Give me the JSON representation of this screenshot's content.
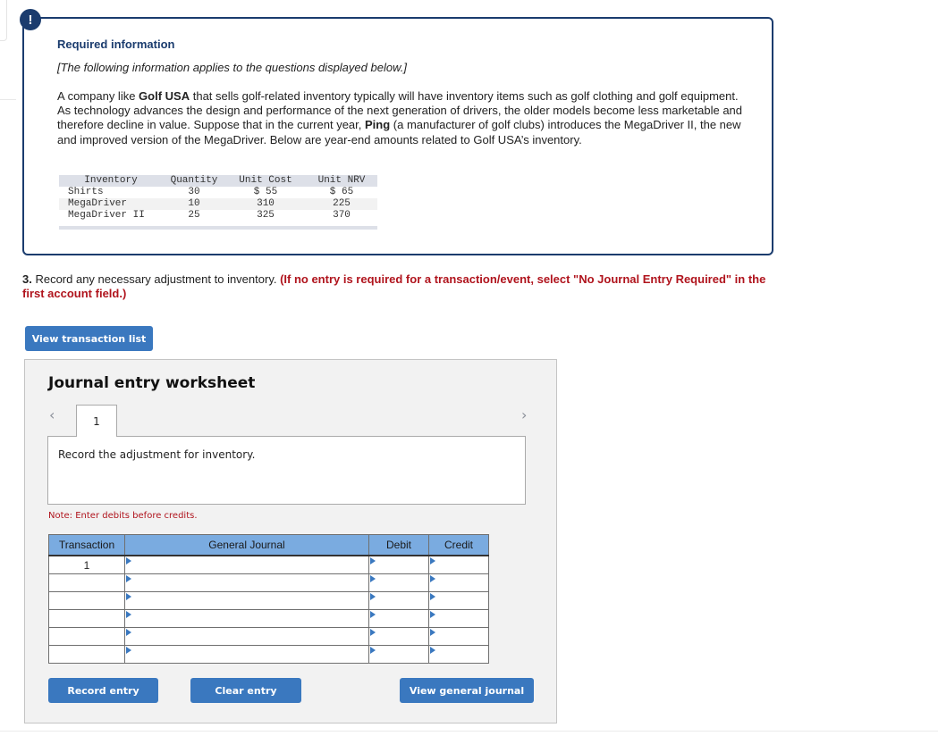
{
  "info": {
    "badge": "!",
    "title": "Required information",
    "subtitle": "[The following information applies to the questions displayed below.]",
    "paragraph_parts": {
      "p1": "A company like ",
      "b1": "Golf USA",
      "p2": " that sells golf-related inventory typically will have inventory items such as golf clothing and golf equipment. As technology advances the design and performance of the next generation of drivers, the older models become less marketable and therefore decline in value. Suppose that in the current year, ",
      "b2": "Ping",
      "p3": " (a manufacturer of golf clubs) introduces the MegaDriver II, the new and improved version of the MegaDriver. Below are year-end amounts related to Golf USA’s inventory."
    },
    "inventory_table": {
      "headers": [
        "Inventory",
        "Quantity",
        "Unit Cost",
        "Unit NRV"
      ],
      "rows": [
        [
          "Shirts",
          "30",
          "$ 55",
          "$ 65"
        ],
        [
          "MegaDriver",
          "10",
          "310",
          "225"
        ],
        [
          "MegaDriver II",
          "25",
          "325",
          "370"
        ]
      ]
    }
  },
  "question": {
    "number": "3.",
    "text": " Record any necessary adjustment to inventory. ",
    "instruction": "(If no entry is required for a transaction/event, select \"No Journal Entry Required\" in the first account field.)"
  },
  "buttons": {
    "view_transaction_list": "View transaction list",
    "record_entry": "Record entry",
    "clear_entry": "Clear entry",
    "view_general_journal": "View general journal"
  },
  "worksheet": {
    "title": "Journal entry worksheet",
    "prev_icon": "‹",
    "next_icon": "›",
    "tabs": [
      "1"
    ],
    "description": "Record the adjustment for inventory.",
    "note": "Note: Enter debits before credits.",
    "table": {
      "headers": [
        "Transaction",
        "General Journal",
        "Debit",
        "Credit"
      ],
      "rows": [
        {
          "transaction": "1",
          "account": "",
          "debit": "",
          "credit": ""
        },
        {
          "transaction": "",
          "account": "",
          "debit": "",
          "credit": ""
        },
        {
          "transaction": "",
          "account": "",
          "debit": "",
          "credit": ""
        },
        {
          "transaction": "",
          "account": "",
          "debit": "",
          "credit": ""
        },
        {
          "transaction": "",
          "account": "",
          "debit": "",
          "credit": ""
        },
        {
          "transaction": "",
          "account": "",
          "debit": "",
          "credit": ""
        }
      ]
    }
  },
  "colors": {
    "primary_navy": "#1b3c6e",
    "button_blue": "#3a78bf",
    "table_header_blue": "#7aabe0",
    "instruction_red": "#b0141d"
  }
}
